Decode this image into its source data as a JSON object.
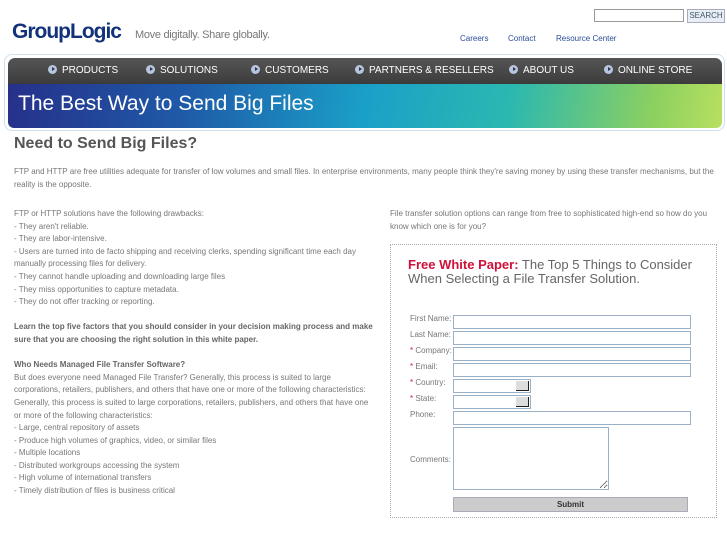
{
  "header": {
    "logo": "GroupLogic",
    "tagline": "Move digitally. Share globally.",
    "search_button": "SEARCH",
    "search_value": "",
    "links": [
      "Careers",
      "Contact",
      "Resource Center"
    ]
  },
  "nav": {
    "items": [
      "PRODUCTS",
      "SOLUTIONS",
      "CUSTOMERS",
      "PARTNERS & RESELLERS",
      "ABOUT US",
      "ONLINE STORE"
    ]
  },
  "banner": {
    "title": "The Best Way to Send Big Files"
  },
  "main": {
    "heading": "Need to Send Big Files?",
    "intro": "FTP and HTTP are free utilities adequate for transfer of low volumes and small files. In enterprise environments, many people think they're saving money by using these transfer mechanisms, but the reality is the opposite.",
    "drawbacks_intro": "FTP or HTTP solutions have the following drawbacks:",
    "drawbacks": [
      "- They aren't reliable.",
      "- They are labor-intensive.",
      "- Users are turned into de facto shipping and receiving clerks, spending significant time each day manually processing files for delivery.",
      "- They cannot handle uploading and downloading large files",
      "- They miss opportunities to capture metadata.",
      "- They do not offer tracking or reporting."
    ],
    "learn": "Learn the top five factors that you should consider in your decision making process and make sure that you are choosing the right solution in this white paper.",
    "who_heading": "Who Needs Managed File Transfer Software?",
    "who_p1": "But does everyone need Managed File Transfer? Generally, this process is suited to large corporations, retailers, publishers, and others that have one or more of the following characteristics:",
    "who_p2": "Generally, this process is suited to large corporations, retailers, publishers, and others that have one or more of the following characteristics:",
    "characteristics": [
      "- Large, central repository of assets",
      "- Produce high volumes of graphics, video, or similar files",
      "- Multiple locations",
      "- Distributed workgroups accessing the system",
      "- High volume of international transfers",
      "- Timely distribution of files is business critical"
    ],
    "right_text": "File transfer solution options can range from free to sophisticated high-end so how do you know which one is for you?"
  },
  "form": {
    "title_highlight": "Free White Paper:",
    "title_rest": " The Top 5 Things to Consider When Selecting a File Transfer Solution.",
    "required_mark": "*",
    "fields": [
      {
        "label": "First Name:",
        "required": false
      },
      {
        "label": "Last Name:",
        "required": false
      },
      {
        "label": "Company:",
        "required": true
      },
      {
        "label": "Email:",
        "required": true
      },
      {
        "label": "Country:",
        "required": true
      },
      {
        "label": "State:",
        "required": true
      },
      {
        "label": "Phone:",
        "required": false
      }
    ],
    "comments_label": "Comments:",
    "submit": "Submit"
  },
  "colors": {
    "accent_red": "#d0103a",
    "link_blue": "#2a4d9a",
    "nav_bg": "#444444"
  }
}
